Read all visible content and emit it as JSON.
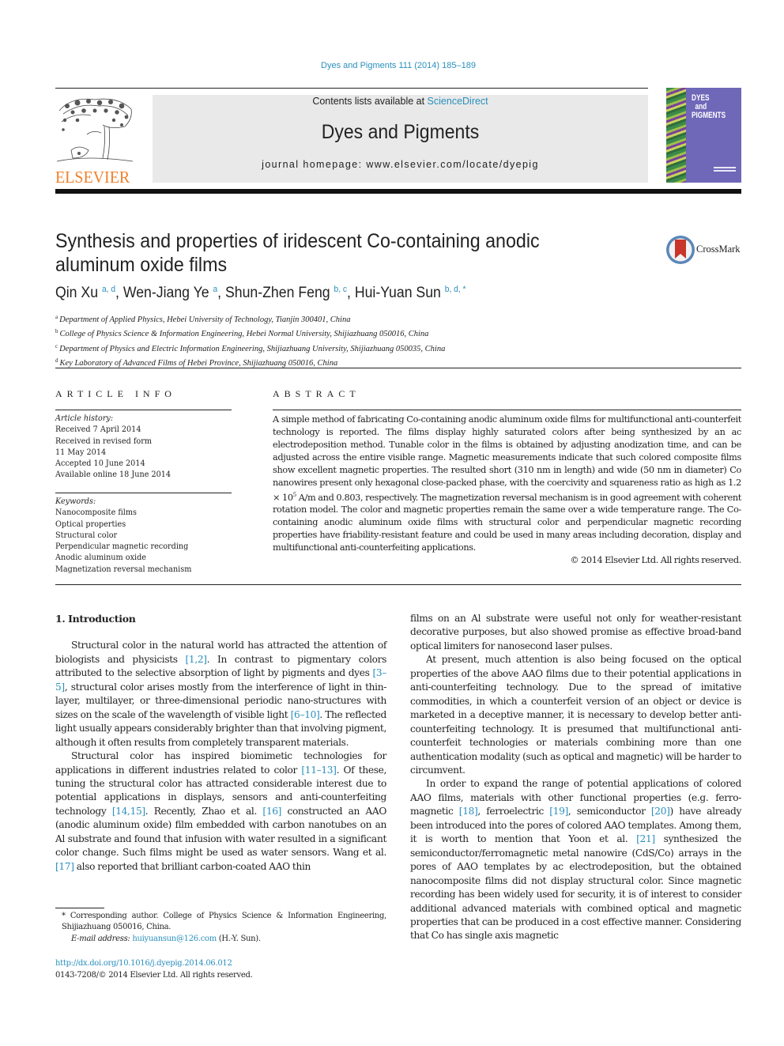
{
  "header": {
    "journal_ref": "Dyes and Pigments 111 (2014) 185–189",
    "contents_prefix": "Contents lists available at ",
    "contents_link": "ScienceDirect",
    "journal_title": "Dyes and Pigments",
    "homepage": "journal homepage: www.elsevier.com/locate/dyepig",
    "publisher_logo_text": "ELSEVIER",
    "cover_title_lines": [
      "DYES",
      "and",
      "PIGMENTS"
    ]
  },
  "colors": {
    "link": "#2a8fbd",
    "elsevier_orange": "#f0802a",
    "cover_purple": "#6f67b8",
    "masthead_gray": "#e9e9e9"
  },
  "article": {
    "title": "Synthesis and properties of iridescent Co-containing anodic aluminum oxide films",
    "crossmark_label": "CrossMark",
    "authors": [
      {
        "name": "Qin Xu",
        "affils": "a, d"
      },
      {
        "name": "Wen-Jiang Ye",
        "affils": "a"
      },
      {
        "name": "Shun-Zhen Feng",
        "affils": "b, c"
      },
      {
        "name": "Hui-Yuan Sun",
        "affils": "b, d, *"
      }
    ],
    "affiliations": [
      {
        "key": "a",
        "text": "Department of Applied Physics, Hebei University of Technology, Tianjin 300401, China"
      },
      {
        "key": "b",
        "text": "College of Physics Science & Information Engineering, Hebei Normal University, Shijiazhuang 050016, China"
      },
      {
        "key": "c",
        "text": "Department of Physics and Electric Information Engineering, Shijiazhuang University, Shijiazhuang 050035, China"
      },
      {
        "key": "d",
        "text": "Key Laboratory of Advanced Films of Hebei Province, Shijiazhuang 050016, China"
      }
    ]
  },
  "article_info": {
    "heading": "ARTICLE INFO",
    "history_label": "Article history:",
    "history": [
      "Received 7 April 2014",
      "Received in revised form",
      "11 May 2014",
      "Accepted 10 June 2014",
      "Available online 18 June 2014"
    ],
    "keywords_label": "Keywords:",
    "keywords": [
      "Nanocomposite films",
      "Optical properties",
      "Structural color",
      "Perpendicular magnetic recording",
      "Anodic aluminum oxide",
      "Magnetization reversal mechanism"
    ]
  },
  "abstract": {
    "heading": "ABSTRACT",
    "text_before_sup": "A simple method of fabricating Co-containing anodic aluminum oxide films for multifunctional anti-counterfeit technology is reported. The films display highly saturated colors after being synthesized by an ac electrodeposition method. Tunable color in the films is obtained by adjusting anodization time, and can be adjusted across the entire visible range. Magnetic measurements indicate that such colored composite films show excellent magnetic properties. The resulted short (310 nm in length) and wide (50 nm in diameter) Co nanowires present only hexagonal close-packed phase, with the coercivity and squareness ratio as high as 1.2 × 10",
    "sup": "5",
    "text_after_sup": " A/m and 0.803, respectively. The magnetization reversal mechanism is in good agreement with coherent rotation model. The color and magnetic properties remain the same over a wide temperature range. The Co-containing anodic aluminum oxide films with structural color and perpendicular magnetic recording properties have friability-resistant feature and could be used in many areas including decoration, display and multifunctional anti-counterfeiting applications.",
    "copyright": "© 2014 Elsevier Ltd. All rights reserved."
  },
  "body": {
    "section_heading": "1.  Introduction",
    "p1": [
      {
        "t": "Structural color in the natural world has attracted the attention of biologists and physicists "
      },
      {
        "ref": "[1,2]"
      },
      {
        "t": ". In contrast to pigmentary colors attributed to the selective absorption of light by pigments and dyes "
      },
      {
        "ref": "[3–5]"
      },
      {
        "t": ", structural color arises mostly from the interference of light in thin-layer, multilayer, or three-dimensional periodic nano-structures with sizes on the scale of the wavelength of visible light "
      },
      {
        "ref": "[6–10]"
      },
      {
        "t": ". The reflected light usually appears considerably brighter than that involving pigment, although it often results from completely transparent materials."
      }
    ],
    "p2": [
      {
        "t": "Structural color has inspired biomimetic technologies for applications in different industries related to color "
      },
      {
        "ref": "[11–13]"
      },
      {
        "t": ". Of these, tuning the structural color has attracted considerable interest due to potential applications in displays, sensors and anti-counterfeiting technology "
      },
      {
        "ref": "[14,15]"
      },
      {
        "t": ". Recently, Zhao et al. "
      },
      {
        "ref": "[16]"
      },
      {
        "t": " constructed an AAO (anodic aluminum oxide) film embedded with carbon nanotubes on an Al substrate and found that infusion with water resulted in a significant color change. Such films might be used as water sensors. Wang et al. "
      },
      {
        "ref": "[17]"
      },
      {
        "t": " also reported that brilliant carbon-coated AAO thin"
      }
    ],
    "p2_cont": [
      {
        "t": "films on an Al substrate were useful not only for weather-resistant decorative purposes, but also showed promise as effective broad-band optical limiters for nanosecond laser pulses."
      }
    ],
    "p3": [
      {
        "t": "At present, much attention is also being focused on the optical properties of the above AAO films due to their potential applications in anti-counterfeiting technology. Due to the spread of imitative commodities, in which a counterfeit version of an object or device is marketed in a deceptive manner, it is necessary to develop better anti-counterfeiting technology. It is presumed that multifunctional anti-counterfeit technologies or materials combining more than one authentication modality (such as optical and magnetic) will be harder to circumvent."
      }
    ],
    "p4": [
      {
        "t": "In order to expand the range of potential applications of colored AAO films, materials with other functional properties (e.g. ferro-magnetic "
      },
      {
        "ref": "[18]"
      },
      {
        "t": ", ferroelectric "
      },
      {
        "ref": "[19]"
      },
      {
        "t": ", semiconductor "
      },
      {
        "ref": "[20]"
      },
      {
        "t": ") have already been introduced into the pores of colored AAO templates. Among them, it is worth to mention that Yoon et al. "
      },
      {
        "ref": "[21]"
      },
      {
        "t": " synthesized the semiconductor/ferromagnetic metal nanowire (CdS/Co) arrays in the pores of AAO templates by ac electrodeposition, but the obtained nanocomposite films did not display structural color. Since magnetic recording has been widely used for security, it is of interest to consider additional advanced materials with combined optical and magnetic properties that can be produced in a cost effective manner. Considering that Co has single axis magnetic"
      }
    ]
  },
  "footnote": {
    "corresponding": "* Corresponding author. College of Physics Science & Information Engineering, Shijiazhuang 050016, China.",
    "email_label": "E-mail address: ",
    "email": "huiyuansun@126.com",
    "email_suffix": " (H.-Y. Sun)."
  },
  "footer": {
    "doi": "http://dx.doi.org/10.1016/j.dyepig.2014.06.012",
    "issn_copyright": "0143-7208/© 2014 Elsevier Ltd. All rights reserved."
  }
}
